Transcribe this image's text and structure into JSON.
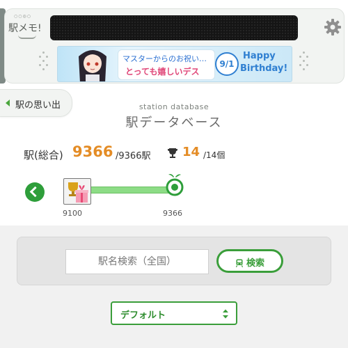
{
  "header": {
    "logo_text": "駅メモ!",
    "logo_dots": "○○◎○",
    "settings_icon": "gear-icon"
  },
  "banner": {
    "message_line1": "マスターからのお祝い…",
    "message_line2": "とっても嬉しいデス",
    "date": "9/1",
    "hb_line1": "Happy",
    "hb_line2": "Birthday!"
  },
  "nav": {
    "back_label": "駅の思い出",
    "back_icon": "triangle-left-icon"
  },
  "page": {
    "subtitle_en": "station database",
    "title_ja": "駅データベース"
  },
  "stats": {
    "label": "駅(総合)",
    "count": "9366",
    "total": "/9366駅",
    "trophy_icon": "trophy-icon",
    "trophy_count": "14",
    "trophy_total": "/14個"
  },
  "progress": {
    "start_value": "9100",
    "end_value": "9366",
    "progress_fraction": 1.0
  },
  "search": {
    "placeholder": "駅名検索（全国）",
    "button_label": "検索",
    "button_icon": "train-icon"
  },
  "sort": {
    "selected": "デフォルト"
  },
  "colors": {
    "accent_green": "#3a9e3a",
    "accent_orange": "#e48c25",
    "progress_fill": "#8ddc86"
  }
}
